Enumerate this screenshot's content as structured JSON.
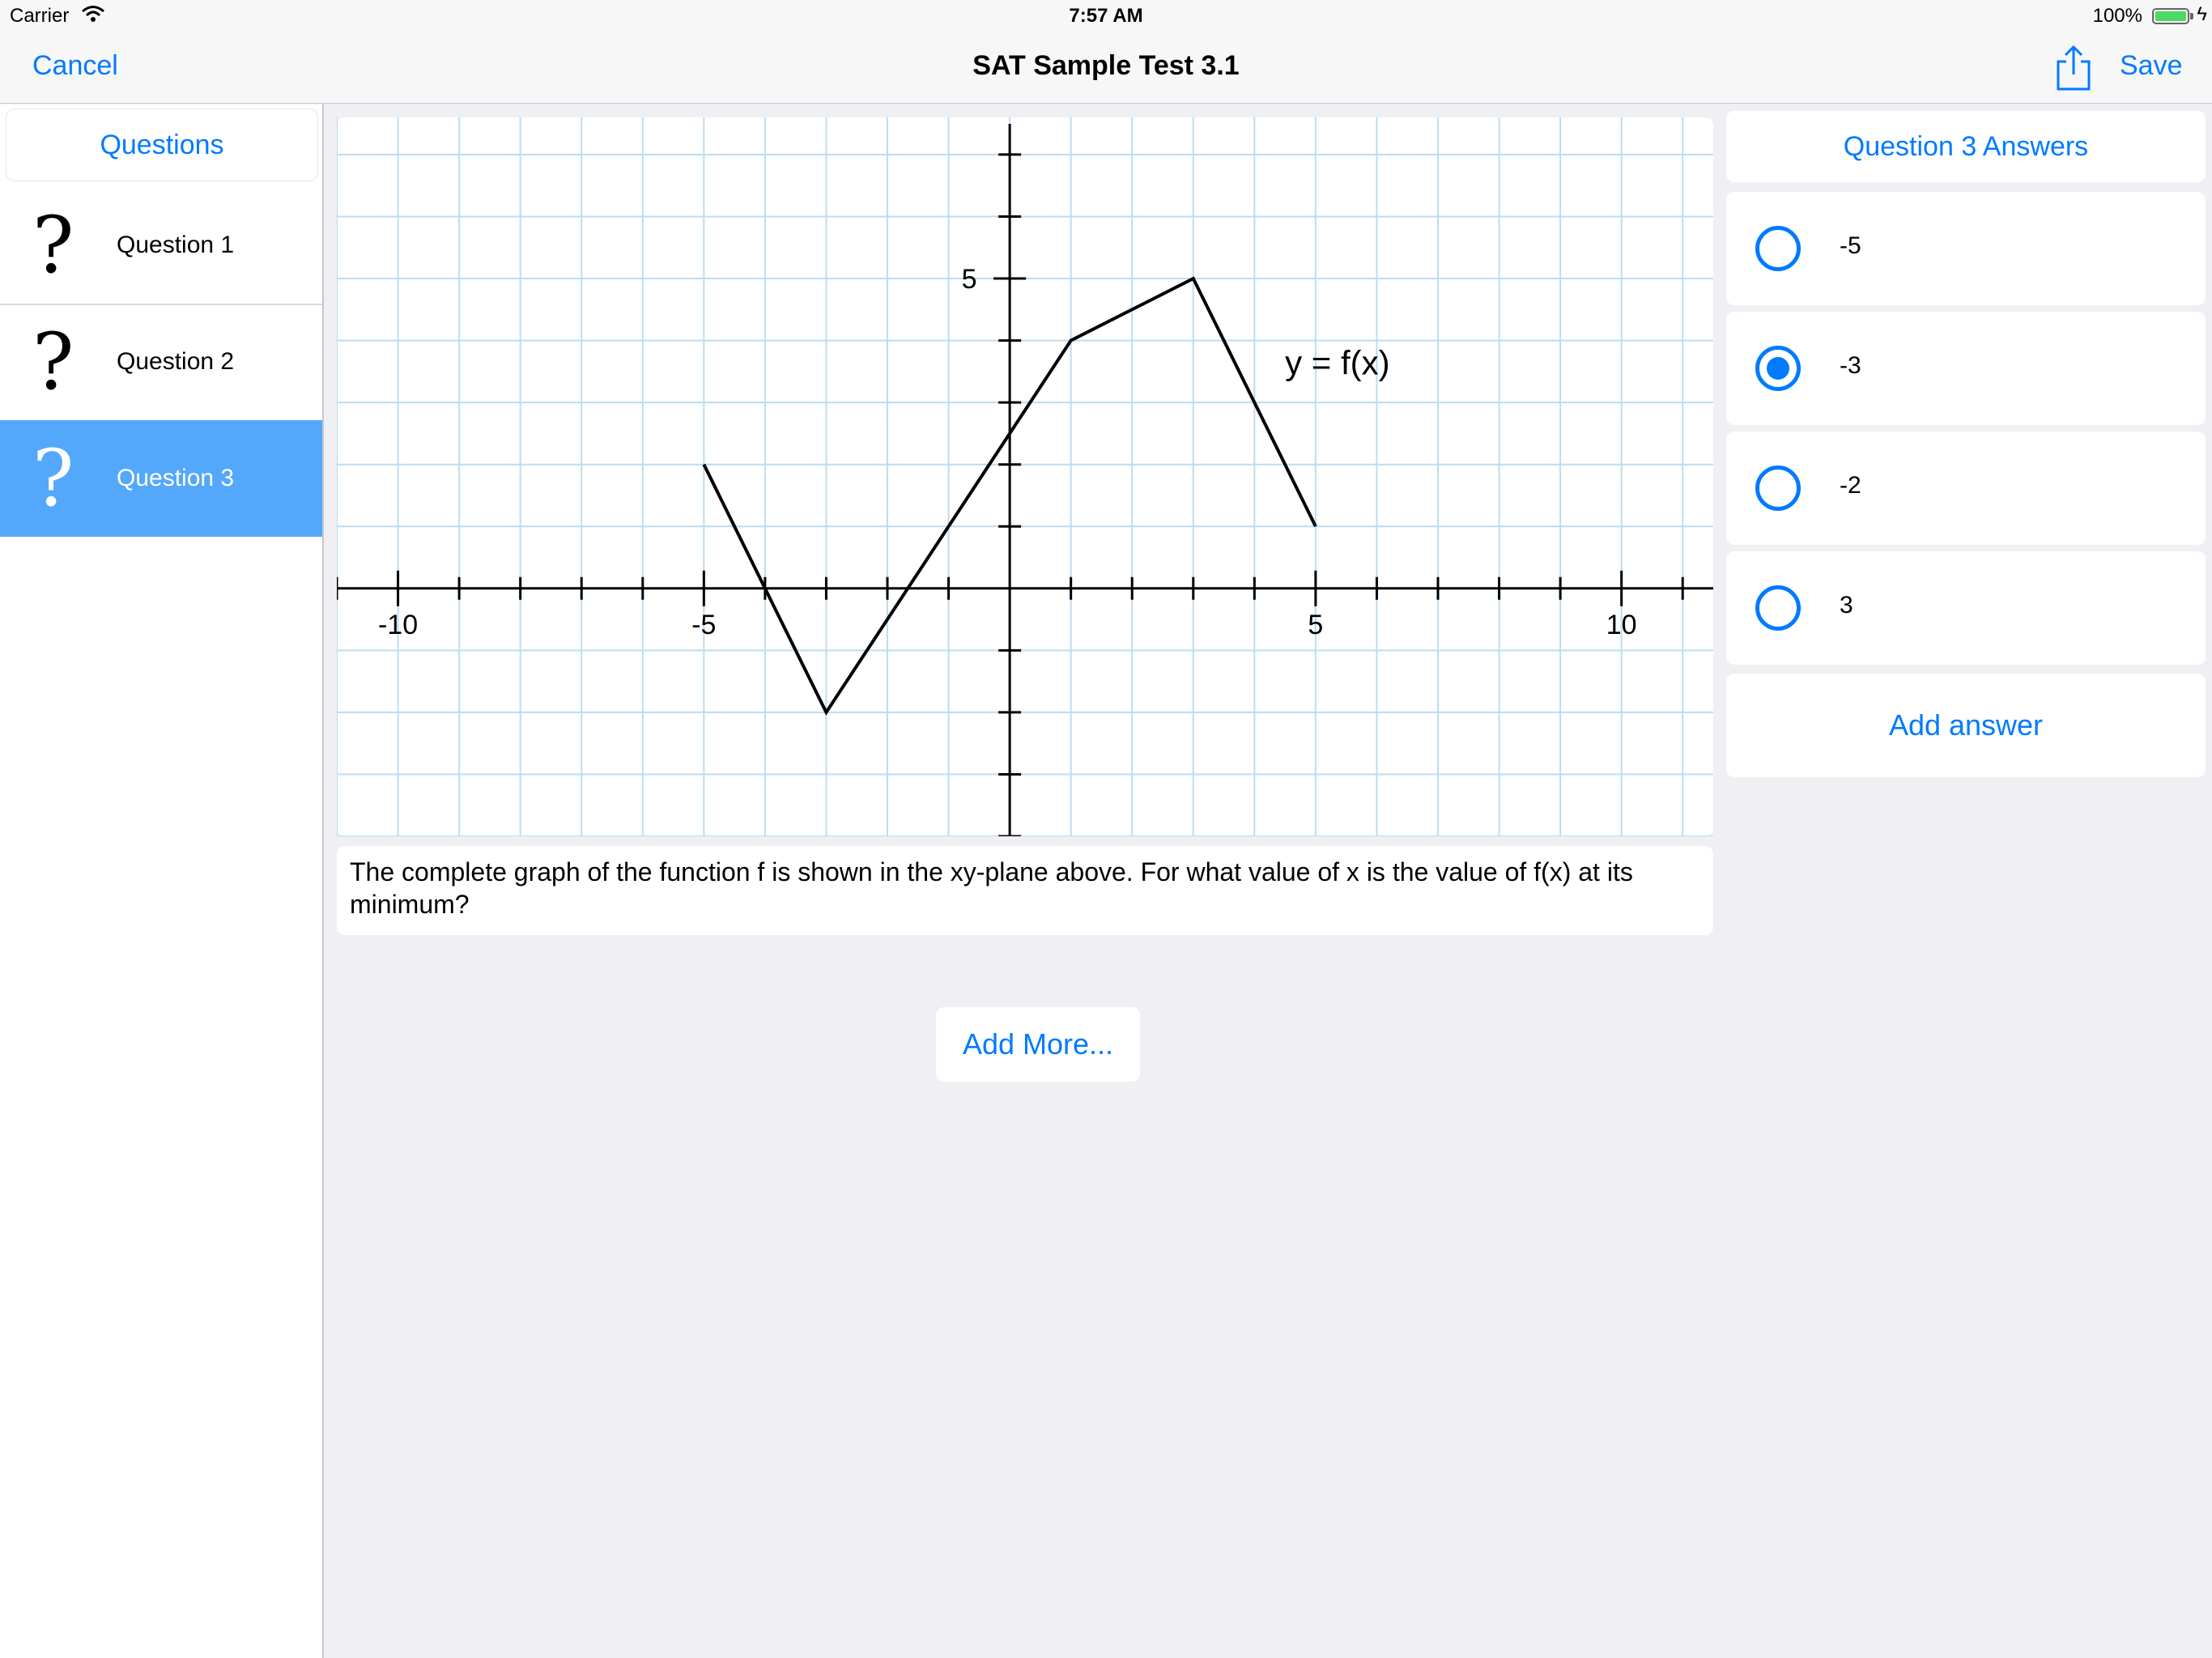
{
  "status_bar": {
    "carrier": "Carrier",
    "time": "7:57 AM",
    "battery": "100%",
    "icons": [
      "wifi-icon",
      "battery-icon",
      "charging-bolt-icon"
    ]
  },
  "nav": {
    "cancel": "Cancel",
    "title": "SAT Sample Test 3.1",
    "save": "Save",
    "share_icon": "share-icon"
  },
  "sidebar": {
    "header": "Questions",
    "items": [
      {
        "icon": "?",
        "label": "Question 1",
        "selected": false
      },
      {
        "icon": "?",
        "label": "Question 2",
        "selected": false
      },
      {
        "icon": "?",
        "label": "Question 3",
        "selected": true
      }
    ]
  },
  "question": {
    "text": "The complete graph of the function f is shown in the xy-plane above. For what value of x is the value of f(x) at its minimum?"
  },
  "chart_data": {
    "type": "line",
    "title": "",
    "series": [
      {
        "name": "y = f(x)",
        "x": [
          -5,
          -3,
          1,
          3,
          5
        ],
        "y": [
          2,
          -2,
          4,
          5,
          1
        ]
      }
    ],
    "xlim": [
      -11,
      11.5
    ],
    "ylim": [
      -4,
      7.6
    ],
    "x_tick_labels": [
      "-10",
      "-5",
      "5",
      "10"
    ],
    "x_tick_values": [
      -10,
      -5,
      5,
      10
    ],
    "y_tick_labels": [
      "5"
    ],
    "y_tick_values": [
      5
    ],
    "annotation": "y = f(x)",
    "grid": true,
    "grid_color": "#bcdcf0"
  },
  "add_more": "Add More...",
  "answers": {
    "header": "Question 3 Answers",
    "options": [
      {
        "value": "-5",
        "selected": false
      },
      {
        "value": "-3",
        "selected": true
      },
      {
        "value": "-2",
        "selected": false
      },
      {
        "value": "3",
        "selected": false
      }
    ],
    "add": "Add answer"
  },
  "colors": {
    "accent": "#007aff",
    "selected_row": "#54a8fb",
    "background": "#efeff4"
  }
}
